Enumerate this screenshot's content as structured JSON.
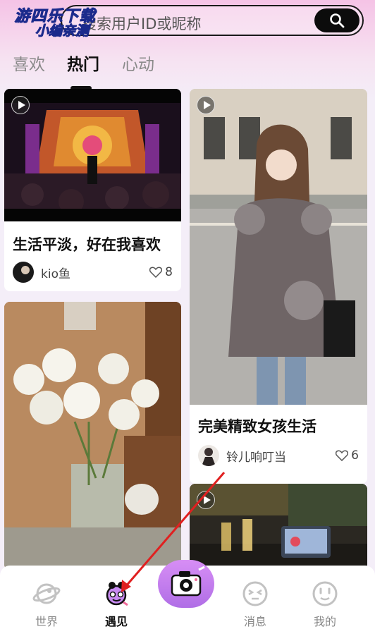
{
  "watermark": {
    "line1": "游四乐下载",
    "line2": "小编亲测"
  },
  "search": {
    "placeholder": "搜索用户ID或昵称",
    "icon": "search-icon"
  },
  "tabs": [
    {
      "label": "喜欢",
      "active": false
    },
    {
      "label": "热门",
      "active": true
    },
    {
      "label": "心动",
      "active": false
    }
  ],
  "feed": {
    "left": [
      {
        "type": "video",
        "title": "生活平淡，好在我喜欢",
        "author": "kio鱼",
        "likes": "8"
      },
      {
        "type": "image",
        "title": "",
        "author": "",
        "likes": ""
      }
    ],
    "right": [
      {
        "type": "video",
        "title": "完美精致女孩生活",
        "author": "铃儿响叮当",
        "likes": "6"
      },
      {
        "type": "video",
        "title": "",
        "author": "",
        "likes": ""
      }
    ]
  },
  "nav": {
    "items": [
      {
        "label": "世界",
        "icon": "planet-icon",
        "active": false
      },
      {
        "label": "遇见",
        "icon": "meet-icon",
        "active": true
      },
      {
        "label": "",
        "icon": "camera-icon",
        "active": false
      },
      {
        "label": "消息",
        "icon": "message-face-icon",
        "active": false
      },
      {
        "label": "我的",
        "icon": "profile-face-icon",
        "active": false
      }
    ]
  },
  "colors": {
    "accent": "#c07ef0",
    "active_text": "#111111",
    "inactive_text": "#888888",
    "annotation_arrow": "#e02020"
  }
}
